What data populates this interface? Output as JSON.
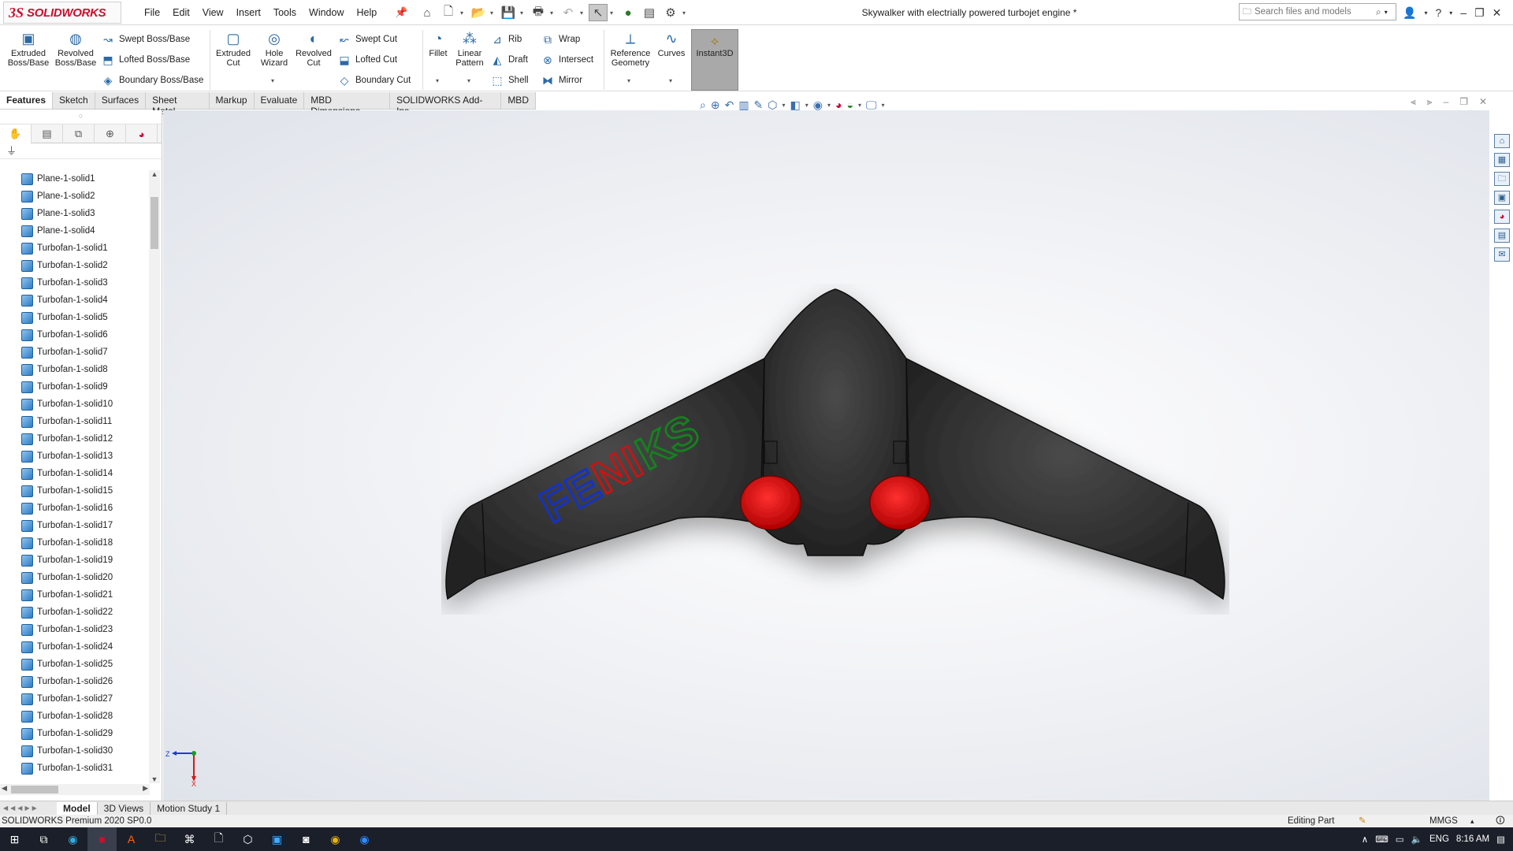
{
  "app": {
    "name": "SOLIDWORKS",
    "logo_text": "3S",
    "doc_title": "Skywalker with electrially powered turbojet engine *"
  },
  "menu": [
    "File",
    "Edit",
    "View",
    "Insert",
    "Tools",
    "Window",
    "Help"
  ],
  "search": {
    "placeholder": "Search files and models"
  },
  "features": {
    "extruded_boss": "Extruded Boss/Base",
    "revolved_boss": "Revolved Boss/Base",
    "swept_boss": "Swept Boss/Base",
    "lofted_boss": "Lofted Boss/Base",
    "boundary_boss": "Boundary Boss/Base",
    "extruded_cut": "Extruded Cut",
    "hole_wizard": "Hole Wizard",
    "revolved_cut": "Revolved Cut",
    "swept_cut": "Swept Cut",
    "lofted_cut": "Lofted Cut",
    "boundary_cut": "Boundary Cut",
    "fillet": "Fillet",
    "linear_pattern": "Linear Pattern",
    "rib": "Rib",
    "draft": "Draft",
    "shell": "Shell",
    "wrap": "Wrap",
    "intersect": "Intersect",
    "mirror": "Mirror",
    "reference_geometry": "Reference Geometry",
    "curves": "Curves",
    "instant3d": "Instant3D"
  },
  "cm_tabs": [
    "Features",
    "Sketch",
    "Surfaces",
    "Sheet Metal",
    "Markup",
    "Evaluate",
    "MBD Dimensions",
    "SOLIDWORKS Add-Ins",
    "MBD"
  ],
  "tree": [
    "Plane-1-solid1",
    "Plane-1-solid2",
    "Plane-1-solid3",
    "Plane-1-solid4",
    "Turbofan-1-solid1",
    "Turbofan-1-solid2",
    "Turbofan-1-solid3",
    "Turbofan-1-solid4",
    "Turbofan-1-solid5",
    "Turbofan-1-solid6",
    "Turbofan-1-solid7",
    "Turbofan-1-solid8",
    "Turbofan-1-solid9",
    "Turbofan-1-solid10",
    "Turbofan-1-solid11",
    "Turbofan-1-solid12",
    "Turbofan-1-solid13",
    "Turbofan-1-solid14",
    "Turbofan-1-solid15",
    "Turbofan-1-solid16",
    "Turbofan-1-solid17",
    "Turbofan-1-solid18",
    "Turbofan-1-solid19",
    "Turbofan-1-solid20",
    "Turbofan-1-solid21",
    "Turbofan-1-solid22",
    "Turbofan-1-solid23",
    "Turbofan-1-solid24",
    "Turbofan-1-solid25",
    "Turbofan-1-solid26",
    "Turbofan-1-solid27",
    "Turbofan-1-solid28",
    "Turbofan-1-solid29",
    "Turbofan-1-solid30",
    "Turbofan-1-solid31"
  ],
  "model_text": {
    "letters": [
      "F",
      "E",
      "N",
      "I",
      "K",
      "S"
    ],
    "colors": [
      "#1432c8",
      "#1432c8",
      "#c81414",
      "#c81414",
      "#14821e",
      "#14821e"
    ]
  },
  "triad": {
    "z": "Z",
    "x": "X"
  },
  "bottom_tabs": [
    "Model",
    "3D Views",
    "Motion Study 1"
  ],
  "status": {
    "left": "SOLIDWORKS Premium 2020 SP0.0",
    "editing": "Editing Part",
    "units": "MMGS"
  },
  "taskbar": {
    "lang": "ENG",
    "time": "8:16 AM"
  },
  "colors": {
    "accent": "#c8102e",
    "solid_icon": "#2f7cc2",
    "engine": "#dd1111",
    "fuselage": "#2d2d2d"
  }
}
